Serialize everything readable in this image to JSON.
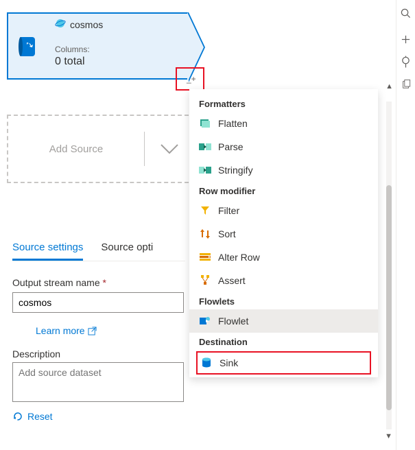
{
  "sourceNode": {
    "service": "cosmos",
    "columnsLabel": "Columns:",
    "columnsValue": "0 total"
  },
  "addSource": {
    "label": "Add Source"
  },
  "menu": {
    "sections": {
      "formatters": {
        "title": "Formatters",
        "flatten": "Flatten",
        "parse": "Parse",
        "stringify": "Stringify"
      },
      "rowmod": {
        "title": "Row modifier",
        "filter": "Filter",
        "sort": "Sort",
        "alterRow": "Alter Row",
        "assert": "Assert"
      },
      "flowlets": {
        "title": "Flowlets",
        "flowlet": "Flowlet"
      },
      "destination": {
        "title": "Destination",
        "sink": "Sink"
      }
    }
  },
  "tabs": {
    "sourceSettings": "Source settings",
    "sourceOptions": "Source opti"
  },
  "form": {
    "outputStreamLabel": "Output stream name",
    "outputStreamValue": "cosmos",
    "learnMore": "Learn more",
    "descriptionLabel": "Description",
    "descriptionPlaceholder": "Add source dataset",
    "reset": "Reset"
  }
}
